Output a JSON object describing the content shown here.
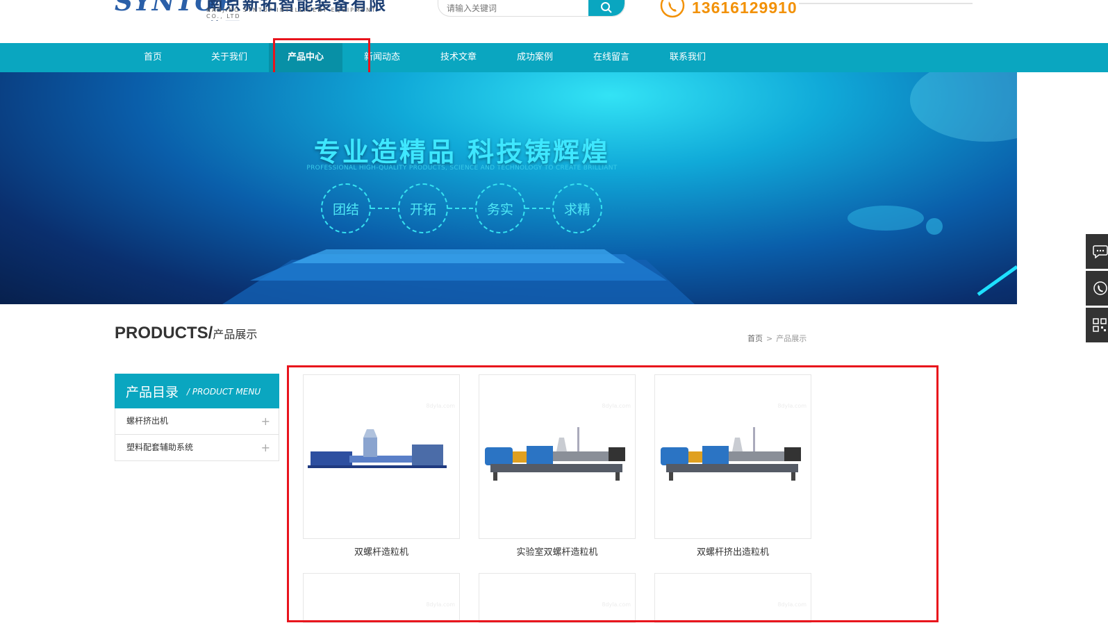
{
  "header": {
    "logo_text": "SYNTOP",
    "company_cn": "南京新拓智能装备有限公司",
    "company_en": "NANJING SYNTOP INTELLIGENT EQUIPMENT CO., LTD",
    "search_placeholder": "请输入关键词",
    "phone": "13616129910"
  },
  "nav": {
    "items": [
      {
        "label": "首页"
      },
      {
        "label": "关于我们"
      },
      {
        "label": "产品中心"
      },
      {
        "label": "新闻动态"
      },
      {
        "label": "技术文章"
      },
      {
        "label": "成功案例"
      },
      {
        "label": "在线留言"
      },
      {
        "label": "联系我们"
      }
    ],
    "active": "产品中心"
  },
  "banner": {
    "title": "专业造精品   科技铸辉煌",
    "subtitle": "PROFESSIONAL HIGH-QUALITY PRODUCTS, SCIENCE AND TECHNOLOGY TO CREATE BRILLIANT",
    "values": [
      "团结",
      "开拓",
      "务实",
      "求精"
    ]
  },
  "section": {
    "title_en": "PRODUCTS/",
    "title_cn": "产品展示",
    "breadcrumb_home": "首页",
    "breadcrumb_sep": ">",
    "breadcrumb_current": "产品展示"
  },
  "sidebar": {
    "title_cn": "产品目录",
    "title_en": "/ PRODUCT MENU",
    "items": [
      {
        "label": "螺杆挤出机"
      },
      {
        "label": "塑料配套辅助系统"
      }
    ]
  },
  "products": [
    {
      "name": "双螺杆造粒机"
    },
    {
      "name": "实验室双螺杆造粒机"
    },
    {
      "name": "双螺杆挤出造粒机"
    }
  ],
  "watermark": "8dyla.com",
  "colors": {
    "primary": "#0aa6c0",
    "phone": "#f29107",
    "highlight": "#e8141c"
  },
  "icons": [
    "search-icon",
    "phone-icon",
    "plus-icon",
    "chat-icon",
    "call-icon",
    "qrcode-icon"
  ]
}
